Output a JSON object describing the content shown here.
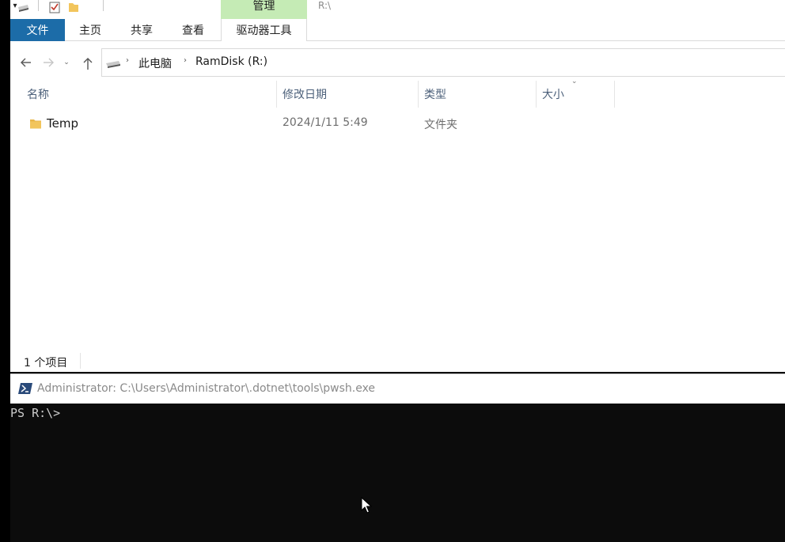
{
  "titlebar": {
    "context_tab": "管理",
    "path": "R:\\",
    "quick_access": [
      "drive-icon",
      "properties-icon",
      "folder-icon",
      "dropdown-icon"
    ]
  },
  "ribbon": {
    "tabs": [
      {
        "label": "文件"
      },
      {
        "label": "主页"
      },
      {
        "label": "共享"
      },
      {
        "label": "查看"
      },
      {
        "label": "驱动器工具"
      }
    ]
  },
  "address": {
    "crumbs": [
      "此电脑",
      "RamDisk (R:)"
    ]
  },
  "columns": [
    "名称",
    "修改日期",
    "类型",
    "大小"
  ],
  "files": [
    {
      "name": "Temp",
      "modified": "2024/1/11 5:49",
      "type": "文件夹",
      "size": ""
    }
  ],
  "status": {
    "item_count": "1 个项目"
  },
  "console": {
    "title": "Administrator: C:\\Users\\Administrator\\.dotnet\\tools\\pwsh.exe",
    "prompt": "PS R:\\>"
  },
  "colors": {
    "file_tab": "#1c6ca8",
    "manage_context": "#c5ebb5",
    "console_bg": "#0c0c0c",
    "folder": "#f2c55c"
  }
}
